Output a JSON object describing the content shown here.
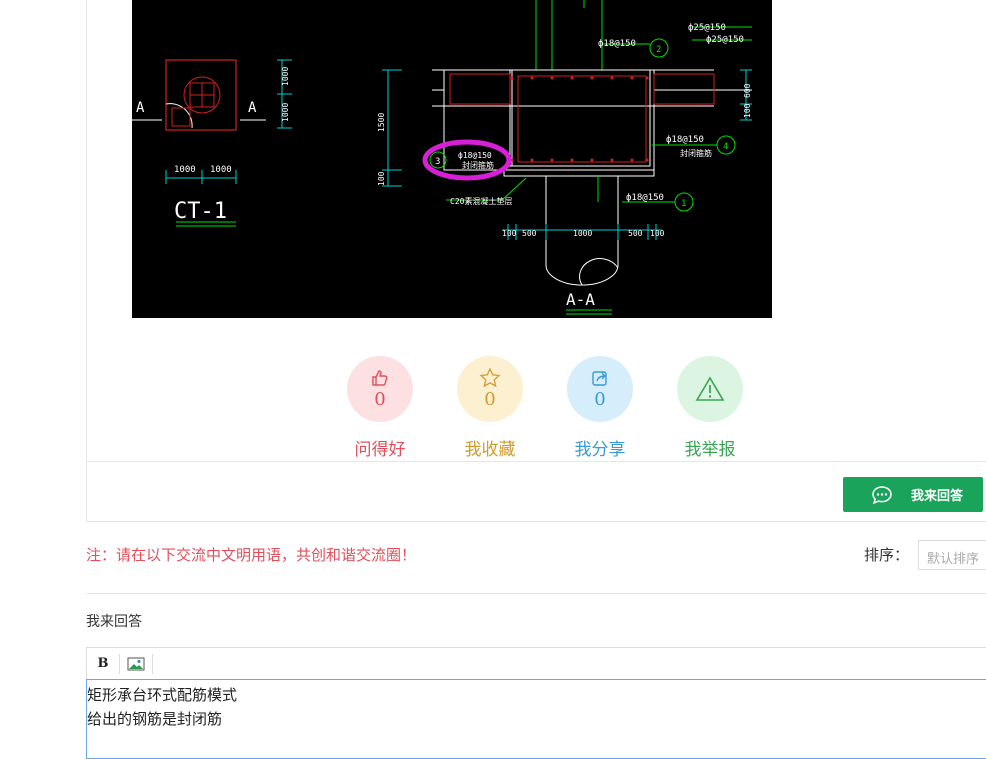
{
  "drawing": {
    "labels": {
      "section_mark_left": "A",
      "section_mark_right": "A",
      "cap_name": "CT-1",
      "dim_1000_a": "1000",
      "dim_1000_b": "1000",
      "dim_1000_v1": "1000",
      "dim_1000_v2": "1000",
      "rebar_1": "ф18@150",
      "rebar_2": "ф18@150",
      "rebar_3": "ф18@150",
      "rebar_4": "ф18@150",
      "rebar_top_1": "ф25@150",
      "rebar_top_2": "ф25@150",
      "ring_note": "封闭箍筋",
      "ring_note_2": "封闭箍筋",
      "bedding": "C20素混凝土垫层",
      "callout_1": "1",
      "callout_2": "2",
      "callout_3": "3",
      "callout_4": "4",
      "dim_1500": "1500",
      "dim_100": "100",
      "dim_600": "600",
      "dim_100b": "100",
      "bottom_dims": [
        "100",
        "500",
        "1000",
        "500",
        "100"
      ],
      "section_title": "A-A"
    }
  },
  "stats": {
    "like": {
      "count": "0",
      "label": "问得好"
    },
    "favorite": {
      "count": "0",
      "label": "我收藏"
    },
    "share": {
      "count": "0",
      "label": "我分享"
    },
    "report": {
      "count": "0",
      "label": "我举报"
    }
  },
  "answer_button": {
    "label": "我来回答"
  },
  "notice": "注：请在以下交流中文明用语，共创和谐交流圈！",
  "sort": {
    "label": "排序：",
    "selected": "默认排序"
  },
  "reply_section": {
    "title": "我来回答",
    "toolbar": {
      "bold": "B"
    },
    "content_lines": [
      "矩形承台环式配筋模式",
      "给出的钢筋是封闭筋"
    ]
  },
  "colors": {
    "like": "#e0505c",
    "favorite": "#d39a2c",
    "share": "#3a9ad6",
    "report": "#3aa655",
    "button": "#1aa35a",
    "notice": "#e0505c"
  }
}
